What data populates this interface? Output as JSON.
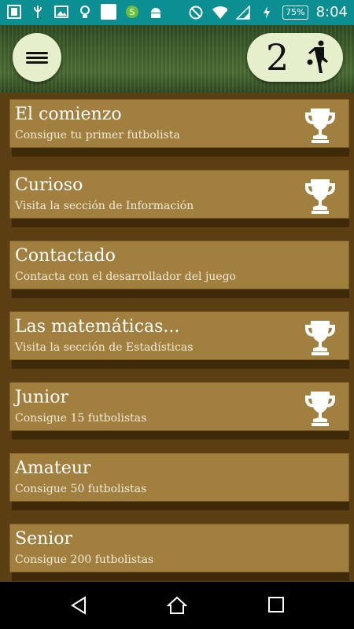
{
  "status_bar": {
    "battery": "75%",
    "time": "8:04",
    "icons": [
      "gallery-app-icon",
      "usb-icon",
      "image-icon",
      "bulb-icon",
      "white-square-icon",
      "shop-s-icon",
      "android-icon",
      "do-not-disturb-icon",
      "wifi-icon",
      "signal-icon",
      "charging-icon"
    ]
  },
  "header": {
    "menu_icon": "hamburger-menu-icon",
    "score": "2",
    "score_icon": "footballer-kicking-icon"
  },
  "achievements": [
    {
      "title": "El comienzo",
      "subtitle": "Consigue tu primer futbolista",
      "unlocked": true
    },
    {
      "title": "Curioso",
      "subtitle": "Visita la sección de Información",
      "unlocked": true
    },
    {
      "title": "Contactado",
      "subtitle": "Contacta con el desarrollador del juego",
      "unlocked": false
    },
    {
      "title": "Las matemáticas...",
      "subtitle": "Visita la sección de Estadísticas",
      "unlocked": true
    },
    {
      "title": "Junior",
      "subtitle": "Consigue 15 futbolistas",
      "unlocked": true
    },
    {
      "title": "Amateur",
      "subtitle": "Consigue 50 futbolistas",
      "unlocked": false
    },
    {
      "title": "Senior",
      "subtitle": "Consigue 200 futbolistas",
      "unlocked": false
    }
  ],
  "colors": {
    "status_bar": "#0b8f92",
    "card": "#a07f3f",
    "list_bg": "#5b3f12",
    "pill": "#e6efcc"
  },
  "nav": [
    "back-icon",
    "home-icon",
    "recents-icon"
  ]
}
